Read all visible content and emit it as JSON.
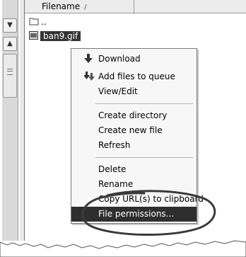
{
  "file_list": {
    "column_header": "Filename",
    "sort_indicator": "/",
    "rows": [
      {
        "name": "..",
        "icon": "folder-up-icon"
      },
      {
        "name": "ban9.gif",
        "icon": "gif-file-icon",
        "selected": true
      }
    ]
  },
  "context_menu": {
    "items": [
      {
        "label": "Download",
        "icon": "download-arrow-icon"
      },
      {
        "label": "Add files to queue",
        "icon": "add-to-queue-icon"
      },
      {
        "label": "View/Edit"
      },
      {
        "label": "Create directory"
      },
      {
        "label": "Create new file"
      },
      {
        "label": "Refresh"
      },
      {
        "label": "Delete"
      },
      {
        "label": "Rename"
      },
      {
        "label": "Copy URL(s) to clipboard"
      },
      {
        "label": "File permissions...",
        "highlighted": true
      }
    ]
  },
  "scrollbar": {
    "up_icon": "chevron-down-icon",
    "down_icon": "chevron-up-icon"
  },
  "colors": {
    "selection": "#333333",
    "menu_highlight": "#2e2e2e",
    "menu_bg": "#f7f7f7"
  }
}
